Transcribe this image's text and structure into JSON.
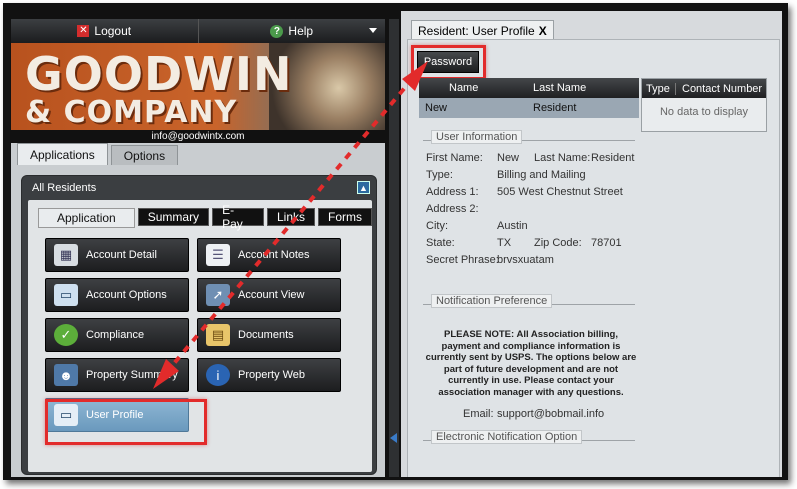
{
  "topbar": {
    "logout_label": "Logout",
    "help_label": "Help"
  },
  "banner": {
    "line1": "GOODWIN",
    "line2": "& COMPANY",
    "email": "info@goodwintx.com"
  },
  "main_tabs": [
    {
      "label": "Applications",
      "active": true
    },
    {
      "label": "Options",
      "active": false
    }
  ],
  "panel": {
    "title": "All Residents",
    "sub_tabs": [
      {
        "label": "Application",
        "active": true
      },
      {
        "label": "Summary",
        "active": false
      },
      {
        "label": "E-Pay",
        "active": false
      },
      {
        "label": "Links",
        "active": false
      },
      {
        "label": "Forms",
        "active": false
      }
    ],
    "tiles": [
      {
        "label": "Account Detail",
        "icon": "calculator-icon"
      },
      {
        "label": "Account Notes",
        "icon": "document-icon"
      },
      {
        "label": "Account Options",
        "icon": "id-card-icon"
      },
      {
        "label": "Account View",
        "icon": "cursor-grid-icon"
      },
      {
        "label": "Compliance",
        "icon": "checkmark-icon"
      },
      {
        "label": "Documents",
        "icon": "folder-icon"
      },
      {
        "label": "Property Summary",
        "icon": "people-icon"
      },
      {
        "label": "Property Web",
        "icon": "info-person-icon"
      },
      {
        "label": "User Profile",
        "icon": "user-card-icon",
        "selected": true
      }
    ]
  },
  "right": {
    "tab_label": "Resident: User Profile",
    "tab_close": "X",
    "password_button": "Password",
    "resident_grid": {
      "headers": [
        "Name",
        "Last Name"
      ],
      "row": [
        "New",
        "Resident"
      ]
    },
    "contact_grid": {
      "headers": [
        "Type",
        "Contact Number"
      ],
      "empty_text": "No data to display"
    },
    "user_info": {
      "legend": "User Information",
      "first_name_label": "First Name:",
      "first_name": "New",
      "last_name_label": "Last Name:",
      "last_name": "Resident",
      "type_label": "Type:",
      "type": "Billing and Mailing",
      "address1_label": "Address 1:",
      "address1": "505 West Chestnut Street",
      "address2_label": "Address 2:",
      "address2": "",
      "city_label": "City:",
      "city": "Austin",
      "state_label": "State:",
      "state": "TX",
      "zip_label": "Zip Code:",
      "zip": "78701",
      "secret_label": "Secret Phrase:",
      "secret": "brvsxuatam"
    },
    "notification": {
      "legend": "Notification Preference",
      "note": "PLEASE NOTE: All Association billing, payment and compliance information is currently sent by USPS. The options below are part of future development and are not currently in use. Please contact your association manager with any questions.",
      "email_label": "Email:",
      "email": "support@bobmail.info",
      "electronic_legend": "Electronic Notification Option"
    }
  },
  "colors": {
    "highlight_red": "#e22b2b",
    "selected_tile": "#7aa6c8",
    "header_dark": "#1f2022"
  }
}
